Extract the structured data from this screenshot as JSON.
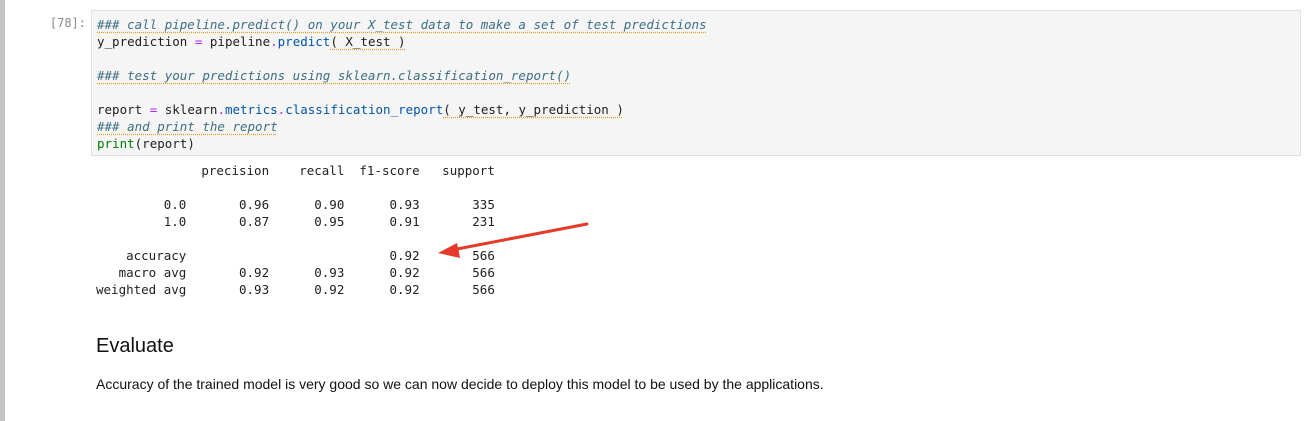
{
  "notebook": {
    "left_bar_color": "#c4c4c4",
    "cell": {
      "prompt": "[78]:",
      "code_lines": [
        [
          {
            "t": "### call pipeline.predict() on your X_test data to make a set of test predictions",
            "c": "cm sq"
          }
        ],
        [
          {
            "t": "y_prediction ",
            "c": ""
          },
          {
            "t": "=",
            "c": "op"
          },
          {
            "t": " pipeline",
            "c": ""
          },
          {
            "t": ".",
            "c": "op"
          },
          {
            "t": "predict",
            "c": "fn"
          },
          {
            "t": "( X_test )",
            "c": "sq"
          }
        ],
        [
          {
            "t": "",
            "c": ""
          }
        ],
        [
          {
            "t": "### test your predictions using sklearn.classification_report()",
            "c": "cm sq"
          }
        ],
        [
          {
            "t": "",
            "c": ""
          }
        ],
        [
          {
            "t": "report ",
            "c": ""
          },
          {
            "t": "=",
            "c": "op"
          },
          {
            "t": " sklearn",
            "c": ""
          },
          {
            "t": ".",
            "c": "op"
          },
          {
            "t": "metrics",
            "c": "fn"
          },
          {
            "t": ".",
            "c": "op"
          },
          {
            "t": "classification_report",
            "c": "fn"
          },
          {
            "t": "( y_test, y_prediction )",
            "c": "sq"
          }
        ],
        [
          {
            "t": "### and print the report",
            "c": "cm sq"
          }
        ],
        [
          {
            "t": "print",
            "c": "bi"
          },
          {
            "t": "(report)",
            "c": ""
          }
        ]
      ]
    },
    "output": {
      "lines": [
        "              precision    recall  f1-score   support",
        "",
        "         0.0       0.96      0.90      0.93       335",
        "         1.0       0.87      0.95      0.91       231",
        "",
        "    accuracy                           0.92       566",
        "   macro avg       0.92      0.93      0.92       566",
        "weighted avg       0.93      0.92      0.92       566"
      ]
    },
    "annotation": {
      "arrow_color": "#e53a2a",
      "points_to": "accuracy 0.92"
    },
    "markdown": {
      "heading": "Evaluate",
      "text": "Accuracy of the trained model is very good so we can now decide to deploy this model to be used by the applications."
    }
  }
}
